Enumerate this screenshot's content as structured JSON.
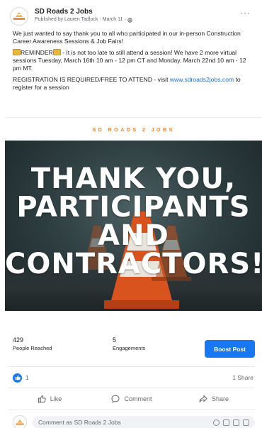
{
  "post": {
    "page_name": "SD Roads 2 Jobs",
    "published_by": "Published by Lauren Tadlock",
    "date": "March 11",
    "dot": "·",
    "more_icon": "more-icon",
    "paragraph_1": "We just wanted to say thank you to all who participated in our in-person Construction Career Awareness Sessions & Job Fairs!",
    "paragraph_2_label": "REMINDER",
    "paragraph_2_text": " - It is not too late to still attend a session! We have 2 more virtual sessions Tuesday, March 16th 10 am - 12 pm CT and Monday, March 22nd 10 am - 12 pm MT.",
    "paragraph_3_text": "REGISTRATION IS REQUIRED/FREE TO ATTEND - visit ",
    "paragraph_3_link": "www.sdroads2jobs.com",
    "paragraph_3_tail": " to register for a session"
  },
  "banner": {
    "strip_text": "SD ROADS 2 JOBS",
    "headline": "THANK YOU, PARTICIPANTS AND CONTRACTORS!"
  },
  "stats": {
    "reached_value": "429",
    "reached_label": "People Reached",
    "engagements_value": "5",
    "engagements_label": "Engagements",
    "boost_label": "Boost Post"
  },
  "reactions": {
    "count": "1",
    "shares": "1 Share"
  },
  "actions": {
    "like": "Like",
    "comment": "Comment",
    "share": "Share"
  },
  "comment_box": {
    "placeholder": "Comment as SD Roads 2 Jobs"
  },
  "colors": {
    "accent": "#1877f2",
    "banner_orange": "#f08a3c",
    "link": "#216fdb"
  }
}
